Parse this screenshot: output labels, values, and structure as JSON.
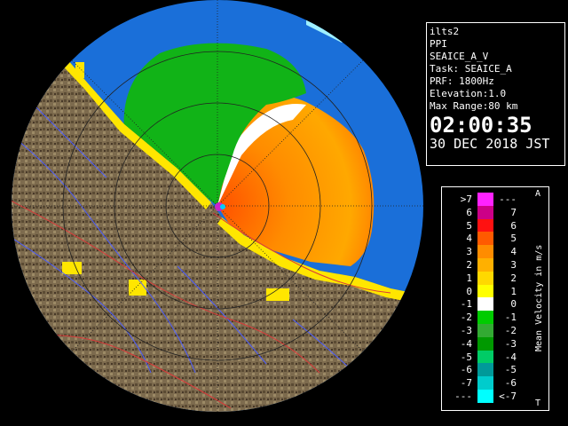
{
  "info": {
    "site": "ilts2",
    "product": "PPI",
    "task_name": "SEAICE_A_V",
    "task": "Task: SEAICE_A",
    "prf": "PRF: 1800Hz",
    "elevation": "Elevation:1.0",
    "max_range": "Max Range:80 km",
    "time": "02:00:35",
    "date": "30 DEC 2018 JST"
  },
  "legend": {
    "unit_label": "Mean Velocity in m/s",
    "top_mark": "A",
    "bottom_mark": "T",
    "rows": [
      {
        "lo": ">7",
        "hi": "---",
        "color": "#ff22ff"
      },
      {
        "lo": "6",
        "hi": "7",
        "color": "#cc0088"
      },
      {
        "lo": "5",
        "hi": "6",
        "color": "#ff1111"
      },
      {
        "lo": "4",
        "hi": "5",
        "color": "#ff5a00"
      },
      {
        "lo": "3",
        "hi": "4",
        "color": "#ff8c00"
      },
      {
        "lo": "2",
        "hi": "3",
        "color": "#ffb000"
      },
      {
        "lo": "1",
        "hi": "2",
        "color": "#ffd800"
      },
      {
        "lo": "0",
        "hi": "1",
        "color": "#ffff00"
      },
      {
        "lo": "-1",
        "hi": "0",
        "color": "#ffffff"
      },
      {
        "lo": "-2",
        "hi": "-1",
        "color": "#00cc00"
      },
      {
        "lo": "-3",
        "hi": "-2",
        "color": "#33aa33"
      },
      {
        "lo": "-4",
        "hi": "-3",
        "color": "#009900"
      },
      {
        "lo": "-5",
        "hi": "-4",
        "color": "#00cc66"
      },
      {
        "lo": "-6",
        "hi": "-5",
        "color": "#009999"
      },
      {
        "lo": "-7",
        "hi": "-6",
        "color": "#00cccc"
      },
      {
        "lo": "---",
        "hi": "<-7",
        "color": "#00ffff"
      }
    ]
  },
  "colors": {
    "sea": "#1a6fd9",
    "land": "#7a6a4e",
    "green_echo": "#11b317",
    "orange_echo": "#ff9a00",
    "yellow_echo": "#ffe600"
  }
}
